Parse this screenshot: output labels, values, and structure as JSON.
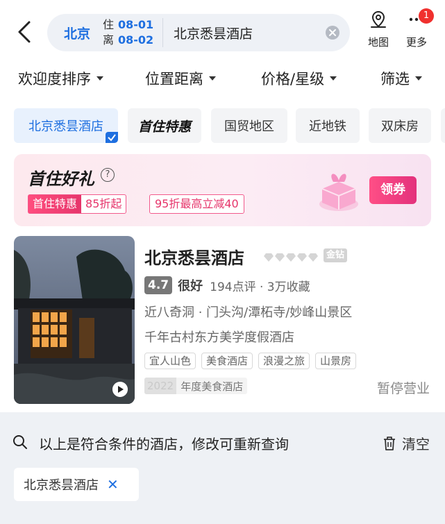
{
  "search": {
    "city": "北京",
    "checkin_label": "住",
    "checkin_date": "08-01",
    "checkout_label": "离",
    "checkout_date": "08-02",
    "query": "北京悉昙酒店"
  },
  "tools": {
    "map_label": "地图",
    "more_label": "更多",
    "more_badge": "1"
  },
  "sort": [
    "欢迎度排序",
    "位置距离",
    "价格/星级",
    "筛选"
  ],
  "chips": {
    "selected": "北京悉昙酒店",
    "promo": "首住特惠",
    "items": [
      "国贸地区",
      "近地铁",
      "双床房"
    ]
  },
  "banner": {
    "title": "首住好礼",
    "help": "?",
    "tag_name": "首住特惠",
    "tag_value": "85折起",
    "tag_second": "95折最高立减40",
    "claim_button": "领券"
  },
  "hotel": {
    "name": "北京悉昙酒店",
    "level": "金钻",
    "score": "4.7",
    "rating_word": "很好",
    "reviews": "194点评 · 3万收藏",
    "location": "近八奇洞 · 门头沟/潭柘寺/妙峰山景区",
    "description": "千年古村东方美学度假酒店",
    "tags": [
      "宜人山色",
      "美食酒店",
      "浪漫之旅",
      "山景房"
    ],
    "award_year": "2022",
    "award_text": "年度美食酒店",
    "status": "暂停营业"
  },
  "bottom": {
    "hint": "以上是符合条件的酒店，修改可重新查询",
    "clear_label": "清空",
    "chip_label": "北京悉昙酒店",
    "chip_close": "✕"
  },
  "colors": {
    "accent_blue": "#1e6fe0",
    "promo_pink": "#e6356b",
    "badge_red": "#f0302e"
  }
}
